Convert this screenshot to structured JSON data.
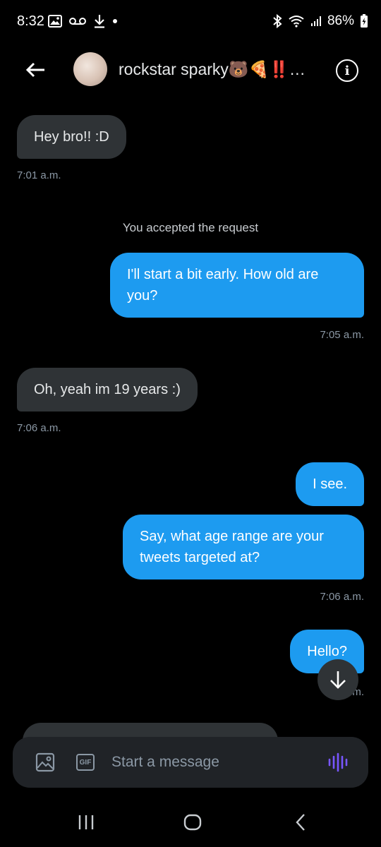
{
  "status_bar": {
    "time": "8:32",
    "battery": "86%",
    "icons": [
      "gallery-icon",
      "voicemail-icon",
      "download-icon",
      "dot-icon",
      "bluetooth-icon",
      "wifi-icon",
      "signal-icon",
      "battery-icon"
    ]
  },
  "header": {
    "contact_name": "rockstar sparky🐻🍕‼️…",
    "info_label": "i",
    "icons": [
      "back-arrow-icon",
      "avatar",
      "info-icon"
    ]
  },
  "conversation": {
    "system_notice": "You accepted the request",
    "messages": [
      {
        "direction": "received",
        "text": "Hey bro!! :D",
        "time": "7:01 a.m."
      },
      {
        "direction": "sent",
        "text": "I'll start a bit early. How old are you?",
        "time": "7:05 a.m."
      },
      {
        "direction": "received",
        "text": "Oh, yeah im 19 years :)",
        "time": "7:06 a.m."
      },
      {
        "direction": "sent",
        "text": "I see.",
        "time": ""
      },
      {
        "direction": "sent",
        "text": "Say, what age range are your tweets targeted at?",
        "time": "7:06 a.m."
      },
      {
        "direction": "sent",
        "text": "Hello?",
        "time": "7:...m."
      }
    ]
  },
  "composer": {
    "placeholder": "Start a message",
    "gif_label": "GIF",
    "icons": [
      "image-icon",
      "gif-icon",
      "voice-message-icon"
    ]
  },
  "colors": {
    "background": "#000000",
    "sent_bubble": "#1d9bf0",
    "received_bubble": "#2f3336",
    "voice_accent": "#7856ff"
  },
  "nav_bar": {
    "icons": [
      "recents-icon",
      "home-icon",
      "back-icon"
    ]
  }
}
